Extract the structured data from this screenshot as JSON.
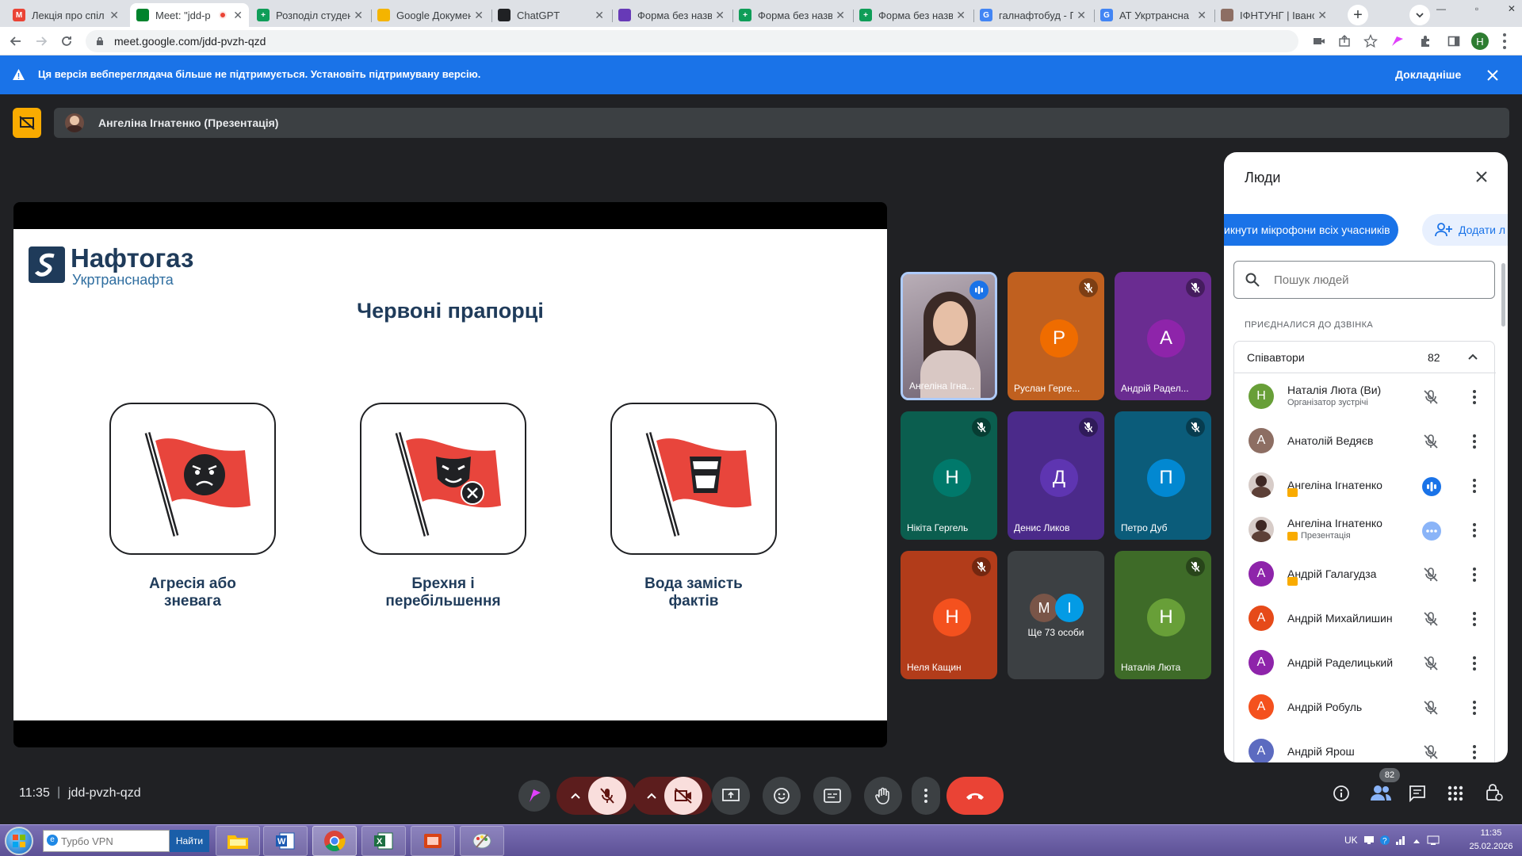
{
  "browser": {
    "tabs": [
      {
        "title": "Лекція про спіл",
        "color": "#ea4335",
        "glyph": "M",
        "active": false
      },
      {
        "title": "Meet: \"jdd-p",
        "color": "#00832d",
        "glyph": "",
        "active": true
      },
      {
        "title": "Розподіл студен",
        "color": "#0f9d58",
        "glyph": "+",
        "active": false
      },
      {
        "title": "Google Докумен",
        "color": "#f4b400",
        "glyph": "",
        "active": false
      },
      {
        "title": "ChatGPT",
        "color": "#202124",
        "glyph": "",
        "active": false
      },
      {
        "title": "Форма без назв",
        "color": "#673ab7",
        "glyph": "",
        "active": false
      },
      {
        "title": "Форма без назв",
        "color": "#0f9d58",
        "glyph": "+",
        "active": false
      },
      {
        "title": "Форма без назв",
        "color": "#0f9d58",
        "glyph": "+",
        "active": false
      },
      {
        "title": "галнафтобуд - П",
        "color": "#4285f4",
        "glyph": "G",
        "active": false
      },
      {
        "title": "АТ Укртрансна",
        "color": "#4285f4",
        "glyph": "G",
        "active": false
      },
      {
        "title": "ІФНТУНГ | Іванс",
        "color": "#8d6e63",
        "glyph": "",
        "active": false
      }
    ],
    "url": "meet.google.com/jdd-pvzh-qzd",
    "profile_initial": "Н"
  },
  "banner": {
    "text": "Ця версія веб­переглядача більше не підтримується. Установіть підтримувану версію.",
    "link": "Докладніше"
  },
  "presenter_bar": {
    "label": "Ангеліна Ігнатенко (Презентація)"
  },
  "slide": {
    "logo_main": "Нафтогаз",
    "logo_sub": "Укртранснафта",
    "title": "Червоні прапорці",
    "cards": [
      {
        "caption_line1": "Агресія або",
        "caption_line2": "зневага",
        "icon": "angry-face-flag-icon"
      },
      {
        "caption_line1": "Брехня і",
        "caption_line2": "перебільшення",
        "icon": "mask-flag-icon"
      },
      {
        "caption_line1": "Вода замість",
        "caption_line2": "фактів",
        "icon": "glass-flag-icon"
      }
    ]
  },
  "tiles": [
    {
      "name": "Ангеліна Ігна...",
      "initial": "",
      "bg": "#8a7a86",
      "av": "",
      "state": "speaking",
      "video": true
    },
    {
      "name": "Руслан Герге...",
      "initial": "Р",
      "bg": "#c0601f",
      "av": "#ef6c00",
      "state": "muted"
    },
    {
      "name": "Андрій Радел...",
      "initial": "А",
      "bg": "#6a2c91",
      "av": "#8e24aa",
      "state": "muted"
    },
    {
      "name": "Нікіта Гергель",
      "initial": "Н",
      "bg": "#0b5e4f",
      "av": "#00796b",
      "state": "muted"
    },
    {
      "name": "Денис Ликов",
      "initial": "Д",
      "bg": "#4b2a8a",
      "av": "#5e35b1",
      "state": "muted"
    },
    {
      "name": "Петро Дуб",
      "initial": "П",
      "bg": "#0b5c7a",
      "av": "#0288d1",
      "state": "muted"
    },
    {
      "name": "Неля Кащин",
      "initial": "Н",
      "bg": "#b23c1a",
      "av": "#f4511e",
      "state": "muted"
    },
    {
      "name": "Ще 73 особи",
      "initial": "",
      "bg": "#3c4043",
      "av": "",
      "state": "more",
      "more_a": "М",
      "more_b": "І"
    },
    {
      "name": "Наталія Люта",
      "initial": "Н",
      "bg": "#3e6b28",
      "av": "#689f38",
      "state": "muted"
    }
  ],
  "people": {
    "title": "Люди",
    "mute_all": "Вимкнути мікрофони всіх учасників",
    "mute_all_visible": "икнути мікрофони всіх учасників",
    "add": "Додати л",
    "search_placeholder": "Пошук людей",
    "joined_label": "ПРИЄДНАЛИСЯ ДО ДЗВІНКА",
    "group_label": "Співавтори",
    "group_count": "82",
    "list": [
      {
        "name": "Наталія Люта (Ви)",
        "sub": "Організатор зустрічі",
        "initial": "Н",
        "color": "#689f38",
        "tag": false,
        "state": "muted"
      },
      {
        "name": "Анатолій Ведяєв",
        "sub": "",
        "initial": "А",
        "color": "#8d6e63",
        "tag": false,
        "state": "muted"
      },
      {
        "name": "Ангеліна Ігнатенко",
        "sub": "",
        "initial": "",
        "color": "#5d4037",
        "tag": true,
        "state": "speaking"
      },
      {
        "name": "Ангеліна Ігнатенко",
        "sub": "Презентація",
        "initial": "",
        "color": "#5d4037",
        "tag": true,
        "state": "presenting"
      },
      {
        "name": "Андрій Галагудза",
        "sub": "",
        "initial": "А",
        "color": "#8e24aa",
        "tag": true,
        "state": "muted"
      },
      {
        "name": "Андрій Михайлишин",
        "sub": "",
        "initial": "А",
        "color": "#e64a19",
        "tag": false,
        "state": "muted"
      },
      {
        "name": "Андрій Раделицький",
        "sub": "",
        "initial": "А",
        "color": "#8e24aa",
        "tag": false,
        "state": "muted"
      },
      {
        "name": "Андрій Робуль",
        "sub": "",
        "initial": "А",
        "color": "#f4511e",
        "tag": false,
        "state": "muted"
      },
      {
        "name": "Андрій Ярош",
        "sub": "",
        "initial": "А",
        "color": "#5c6bc0",
        "tag": false,
        "state": "muted"
      }
    ]
  },
  "bottom": {
    "time": "11:35",
    "separator": "|",
    "meeting_code": "jdd-pvzh-qzd",
    "people_badge": "82"
  },
  "taskbar": {
    "search_placeholder": "Турбо VPN",
    "search_button": "Найти",
    "lang": "UK",
    "clock_time": "11:35",
    "clock_date": "25.02.2026"
  }
}
